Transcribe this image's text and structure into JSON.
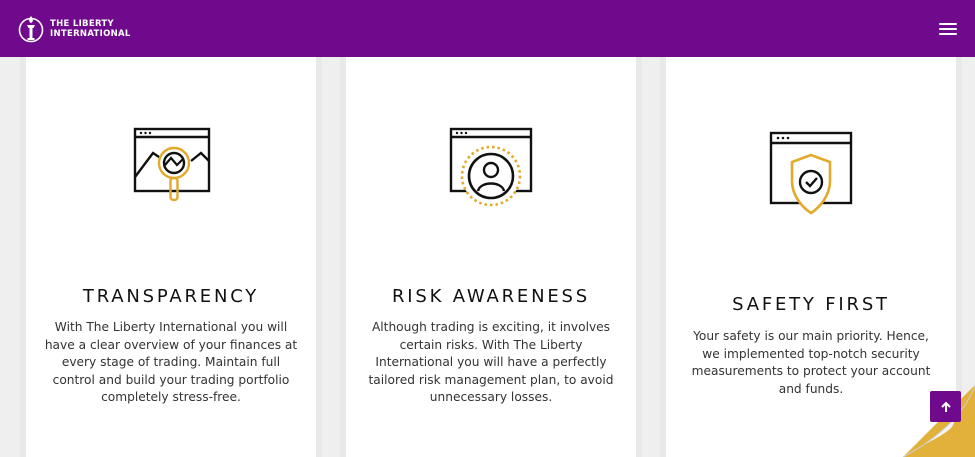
{
  "header": {
    "logo_line1": "THE LIBERTY",
    "logo_line2": "INTERNATIONAL",
    "background": "#6f0a8c"
  },
  "cards": [
    {
      "icon": "magnifier-chart-icon",
      "title": "TRANSPARENCY",
      "text": "With The Liberty International you will have a clear overview of your finances at every stage of trading. Maintain full control and build your trading portfolio completely stress-free."
    },
    {
      "icon": "user-risk-icon",
      "title": "RISK AWARENESS",
      "text": "Although trading is exciting, it involves certain risks. With The Liberty International you will have a perfectly tailored risk management plan, to avoid unnecessary losses."
    },
    {
      "icon": "shield-check-icon",
      "title": "SAFETY FIRST",
      "text": "Your safety is our main priority. Hence, we implemented top-notch security measurements to protect your account and funds."
    }
  ],
  "colors": {
    "accent": "#e2a92a",
    "brand": "#6f0a8c",
    "icon_stroke": "#111111"
  },
  "scroll_top": {
    "icon": "arrow-up-icon"
  }
}
